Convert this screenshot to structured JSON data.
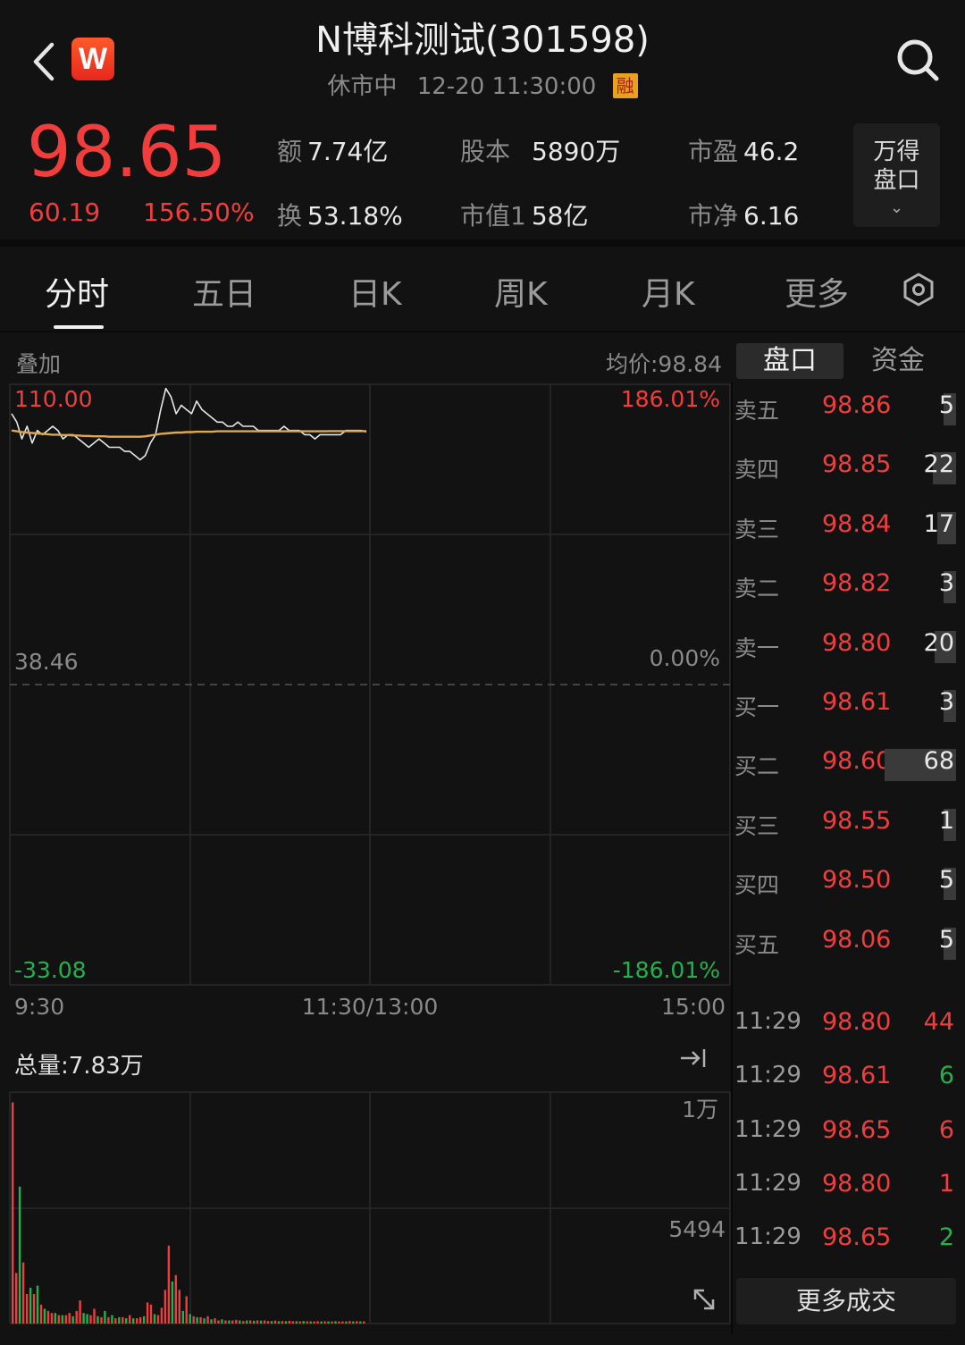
{
  "header": {
    "title": "N博科测试(301598)",
    "status": "休市中",
    "datetime": "12-20 11:30:00",
    "margin_tag": "融",
    "logo_letter": "W"
  },
  "quote": {
    "price": "98.65",
    "change": "60.19",
    "change_pct": "156.50%",
    "stats": [
      {
        "label": "额",
        "value": "7.74亿"
      },
      {
        "label": "股本",
        "value": "5890万"
      },
      {
        "label": "市盈",
        "value": "46.2"
      },
      {
        "label": "换",
        "value": "53.18%"
      },
      {
        "label": "市值1",
        "value": "58亿"
      },
      {
        "label": "市净",
        "value": "6.16"
      }
    ],
    "panel_button": {
      "line1": "万得",
      "line2": "盘口"
    }
  },
  "tabs": [
    "分时",
    "五日",
    "日K",
    "周K",
    "月K",
    "更多"
  ],
  "chart": {
    "overlay_label": "叠加",
    "avg_label": "均价:98.84",
    "price_high": "110.00",
    "price_mid": "38.46",
    "price_low": "-33.08",
    "pct_high": "186.01%",
    "pct_mid": "0.00%",
    "pct_low": "-186.01%",
    "time_start": "9:30",
    "time_mid": "11:30/13:00",
    "time_end": "15:00"
  },
  "chart_data": {
    "type": "line",
    "price_range": [
      -33.08,
      110.0
    ],
    "prev_close": 38.46,
    "series": [
      {
        "values": [
          103,
          101,
          97,
          100,
          96,
          99,
          98,
          99,
          100,
          99,
          97,
          98,
          98,
          97,
          96,
          95,
          96,
          97,
          96,
          95,
          95,
          95,
          94,
          94,
          93,
          92,
          93,
          96,
          98,
          104,
          109,
          107,
          103,
          105,
          104,
          103,
          106,
          104,
          103,
          102,
          101,
          101,
          100,
          100,
          101,
          100,
          100,
          100,
          99,
          99,
          99,
          99,
          99,
          100,
          99,
          99,
          99,
          98,
          98,
          97,
          98,
          98,
          98,
          98,
          98,
          99,
          99,
          99,
          99,
          98.65
        ]
      },
      {
        "values": [
          99,
          98.8,
          98.6,
          98.5,
          98.4,
          98.3,
          98.2,
          98.1,
          98,
          98,
          97.9,
          97.9,
          97.8,
          97.8,
          97.7,
          97.7,
          97.6,
          97.6,
          97.6,
          97.5,
          97.5,
          97.5,
          97.5,
          97.5,
          97.5,
          97.5,
          97.6,
          97.8,
          98,
          98.2,
          98.3,
          98.4,
          98.5,
          98.5,
          98.6,
          98.6,
          98.7,
          98.7,
          98.7,
          98.7,
          98.8,
          98.8,
          98.8,
          98.8,
          98.8,
          98.8,
          98.8,
          98.8,
          98.8,
          98.8,
          98.8,
          98.8,
          98.8,
          98.8,
          98.8,
          98.8,
          98.8,
          98.8,
          98.8,
          98.8,
          98.8,
          98.8,
          98.84,
          98.84,
          98.84,
          98.84,
          98.84,
          98.84,
          98.84,
          98.84
        ]
      }
    ],
    "volume": {
      "total_label": "总量:7.83万",
      "tick_high": "1万",
      "tick_mid": "5494",
      "max": 10988,
      "values": [
        10500,
        2400,
        6500,
        2900,
        1400,
        1700,
        1400,
        1800,
        900,
        700,
        600,
        500,
        500,
        400,
        400,
        400,
        500,
        350,
        600,
        1100,
        500,
        450,
        400,
        700,
        350,
        300,
        600,
        300,
        400,
        250,
        300,
        300,
        250,
        400,
        250,
        250,
        300,
        350,
        1000,
        900,
        450,
        400,
        750,
        1600,
        3700,
        2000,
        2300,
        1600,
        600,
        1300,
        450,
        350,
        300,
        300,
        250,
        350,
        200,
        250,
        150,
        200,
        150,
        150,
        150,
        180,
        150,
        120,
        150,
        150,
        130,
        150,
        140,
        150,
        120,
        120,
        140,
        110,
        120,
        110,
        130,
        110,
        110,
        100,
        120,
        110,
        100,
        100,
        110,
        100,
        110,
        100,
        100,
        110,
        100,
        100,
        100,
        120,
        100,
        110,
        100,
        100
      ],
      "up": [
        true,
        true,
        false,
        true,
        true,
        false,
        true,
        false,
        true,
        false,
        true,
        true,
        false,
        true,
        false,
        true,
        true,
        false,
        true,
        true,
        false,
        false,
        true,
        true,
        false,
        true,
        false,
        true,
        false,
        true,
        false,
        true,
        false,
        true,
        false,
        true,
        true,
        false,
        true,
        true,
        false,
        true,
        true,
        true,
        true,
        false,
        true,
        true,
        false,
        true,
        false,
        true,
        false,
        true,
        false,
        true,
        false,
        true,
        true,
        false,
        true,
        false,
        true,
        true,
        false,
        true,
        false,
        true,
        false,
        true,
        false,
        true,
        true,
        false,
        true,
        false,
        true,
        false,
        true,
        true,
        false,
        true,
        false,
        true,
        false,
        true,
        true,
        false,
        true,
        false,
        true,
        false,
        true,
        true,
        false,
        true,
        false,
        true,
        false,
        true
      ]
    }
  },
  "right_tabs": [
    "盘口",
    "资金"
  ],
  "order_book": [
    {
      "name": "卖五",
      "price": "98.86",
      "vol": "5",
      "bar": 0.08
    },
    {
      "name": "卖四",
      "price": "98.85",
      "vol": "22",
      "bar": 0.32
    },
    {
      "name": "卖三",
      "price": "98.84",
      "vol": "17",
      "bar": 0.26
    },
    {
      "name": "卖二",
      "price": "98.82",
      "vol": "3",
      "bar": 0.06
    },
    {
      "name": "卖一",
      "price": "98.80",
      "vol": "20",
      "bar": 0.3
    },
    {
      "name": "买一",
      "price": "98.61",
      "vol": "3",
      "bar": 0.06
    },
    {
      "name": "买二",
      "price": "98.60",
      "vol": "68",
      "bar": 1.0
    },
    {
      "name": "买三",
      "price": "98.55",
      "vol": "1",
      "bar": 0.04
    },
    {
      "name": "买四",
      "price": "98.50",
      "vol": "5",
      "bar": 0.08
    },
    {
      "name": "买五",
      "price": "98.06",
      "vol": "5",
      "bar": 0.08
    }
  ],
  "trades": [
    {
      "time": "11:29",
      "price": "98.80",
      "vol": "44",
      "dir": "up"
    },
    {
      "time": "11:29",
      "price": "98.61",
      "vol": "6",
      "dir": "down"
    },
    {
      "time": "11:29",
      "price": "98.65",
      "vol": "6",
      "dir": "up"
    },
    {
      "time": "11:29",
      "price": "98.80",
      "vol": "1",
      "dir": "up"
    },
    {
      "time": "11:29",
      "price": "98.65",
      "vol": "2",
      "dir": "down"
    }
  ],
  "more_trades_label": "更多成交",
  "colors": {
    "up": "#f23d3d",
    "down": "#21b24d",
    "price_line": "#e6e6e6",
    "avg_line": "#e0a84a"
  }
}
